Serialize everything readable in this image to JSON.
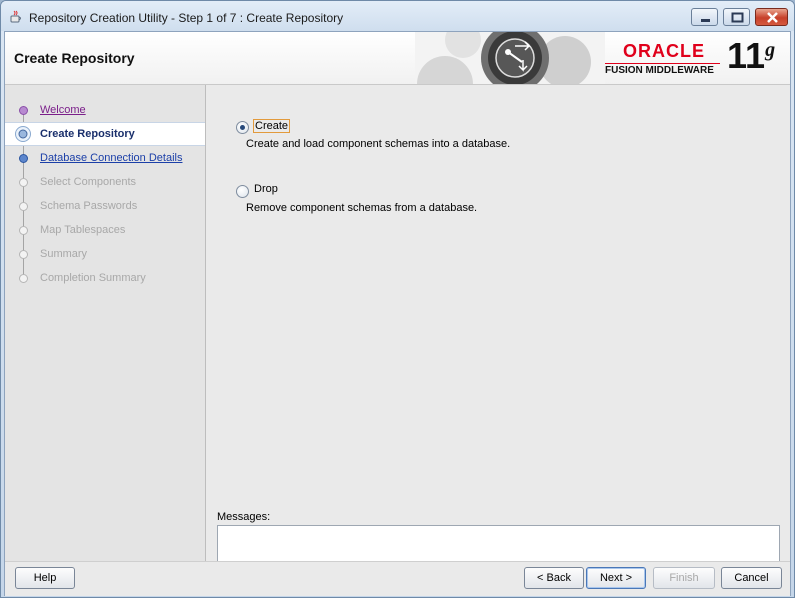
{
  "window": {
    "title": "Repository Creation Utility - Step 1 of 7 : Create Repository"
  },
  "header": {
    "page_title": "Create Repository",
    "brand": "ORACLE",
    "brand_sub": "FUSION MIDDLEWARE",
    "version_num": "11",
    "version_letter": "g"
  },
  "nav": {
    "items": [
      {
        "label": "Welcome",
        "state": "done"
      },
      {
        "label": "Create Repository",
        "state": "current"
      },
      {
        "label": "Database Connection Details",
        "state": "link"
      },
      {
        "label": "Select Components",
        "state": "disabled"
      },
      {
        "label": "Schema Passwords",
        "state": "disabled"
      },
      {
        "label": "Map Tablespaces",
        "state": "disabled"
      },
      {
        "label": "Summary",
        "state": "disabled"
      },
      {
        "label": "Completion Summary",
        "state": "disabled"
      }
    ]
  },
  "options": {
    "create_label": "Create",
    "create_desc": "Create and load component schemas into a database.",
    "drop_label": "Drop",
    "drop_desc": "Remove component schemas from a database.",
    "selected": "create"
  },
  "messages": {
    "label": "Messages:"
  },
  "buttons": {
    "help": "Help",
    "back": "< Back",
    "next": "Next >",
    "finish": "Finish",
    "cancel": "Cancel"
  },
  "icons": {
    "app": "java-cup-icon",
    "minimize": "minimize-icon",
    "maximize": "maximize-icon",
    "close": "close-icon"
  },
  "colors": {
    "oracle_red": "#e0001b",
    "link_blue": "#1b3fa8",
    "visited_purple": "#7b1f8a"
  }
}
